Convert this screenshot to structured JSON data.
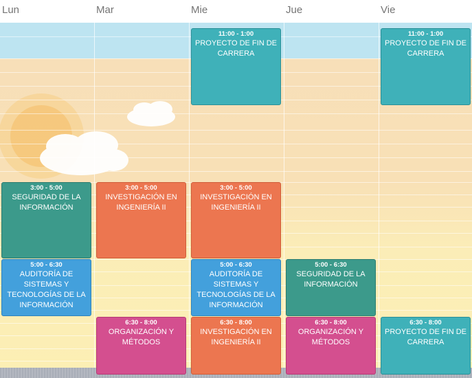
{
  "days": [
    "Lun",
    "Mar",
    "Mie",
    "Jue",
    "Vie"
  ],
  "events": [
    {
      "day": "Mie",
      "time": "11:00 - 1:00",
      "name": "PROYECTO DE FIN DE CARRERA",
      "color": "#3fb1b9"
    },
    {
      "day": "Vie",
      "time": "11:00 - 1:00",
      "name": "PROYECTO DE FIN DE CARRERA",
      "color": "#3fb1b9"
    },
    {
      "day": "Lun",
      "time": "3:00 - 5:00",
      "name": "SEGURIDAD DE LA INFORMACIÓN",
      "color": "#3c9a8b"
    },
    {
      "day": "Mar",
      "time": "3:00 - 5:00",
      "name": "INVESTIGACIÓN EN INGENIERÍA II",
      "color": "#ec7650"
    },
    {
      "day": "Mie",
      "time": "3:00 - 5:00",
      "name": "INVESTIGACIÓN EN INGENIERÍA II",
      "color": "#ec7650"
    },
    {
      "day": "Lun",
      "time": "5:00 - 6:30",
      "name": "AUDITORÍA DE SISTEMAS Y TECNOLOGÍAS DE LA INFORMACIÓN",
      "color": "#43a0dc"
    },
    {
      "day": "Mie",
      "time": "5:00 - 6:30",
      "name": "AUDITORÍA DE SISTEMAS Y TECNOLOGÍAS DE LA INFORMACIÓN",
      "color": "#43a0dc"
    },
    {
      "day": "Jue",
      "time": "5:00 - 6:30",
      "name": "SEGURIDAD DE LA INFORMACIÓN",
      "color": "#3c9a8b"
    },
    {
      "day": "Mar",
      "time": "6:30 - 8:00",
      "name": "ORGANIZACIÓN Y MÉTODOS",
      "color": "#d44f8f"
    },
    {
      "day": "Mie",
      "time": "6:30 - 8:00",
      "name": "INVESTIGACIÓN EN INGENIERÍA II",
      "color": "#ec7650"
    },
    {
      "day": "Jue",
      "time": "6:30 - 8:00",
      "name": "ORGANIZACIÓN Y MÉTODOS",
      "color": "#d44f8f"
    },
    {
      "day": "Vie",
      "time": "6:30 - 8:00",
      "name": "PROYECTO DE FIN DE CARRERA",
      "color": "#3fb1b9"
    }
  ],
  "background": {
    "sky_color": "#bde4f1",
    "sand_color": "#f8e0b6",
    "sun_color": "#f6c56a"
  }
}
